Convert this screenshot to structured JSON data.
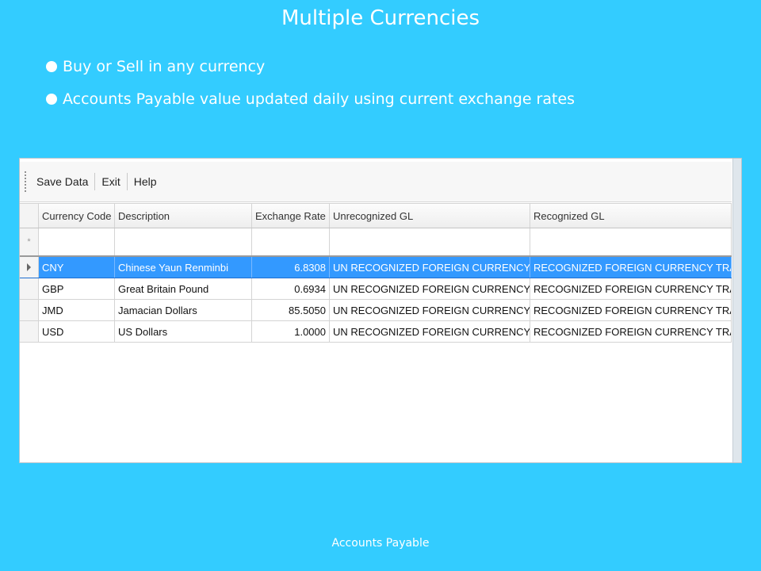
{
  "slide": {
    "title": "Multiple Currencies",
    "bullets": [
      "Buy or Sell in any currency",
      "Accounts Payable value updated daily using current exchange rates"
    ],
    "footer": "Accounts Payable"
  },
  "toolbar": {
    "save_label": "Save Data",
    "exit_label": "Exit",
    "help_label": "Help"
  },
  "grid": {
    "columns": [
      "Currency Code",
      "Description",
      "Exchange Rate",
      "Unrecognized GL",
      "Recognized GL"
    ],
    "new_row_marker": "*",
    "rows": [
      {
        "code": "CNY",
        "description": "Chinese Yaun Renminbi",
        "rate": "6.8308",
        "unrecognized_gl": "UN RECOGNIZED FOREIGN CURRENCY TRANS",
        "recognized_gl": "RECOGNIZED FOREIGN CURRENCY TRANS",
        "selected": true
      },
      {
        "code": "GBP",
        "description": "Great Britain Pound",
        "rate": "0.6934",
        "unrecognized_gl": "UN RECOGNIZED FOREIGN CURRENCY TRANS",
        "recognized_gl": "RECOGNIZED FOREIGN CURRENCY TRANS"
      },
      {
        "code": "JMD",
        "description": "Jamacian Dollars",
        "rate": "85.5050",
        "unrecognized_gl": "UN RECOGNIZED FOREIGN CURRENCY TRANS",
        "recognized_gl": "RECOGNIZED FOREIGN CURRENCY TRANS"
      },
      {
        "code": "USD",
        "description": "US Dollars",
        "rate": "1.0000",
        "unrecognized_gl": "UN RECOGNIZED FOREIGN CURRENCY TRANS",
        "recognized_gl": "RECOGNIZED FOREIGN CURRENCY TRANS"
      }
    ]
  },
  "colors": {
    "background": "#33ccff",
    "selection": "#3399ff"
  }
}
